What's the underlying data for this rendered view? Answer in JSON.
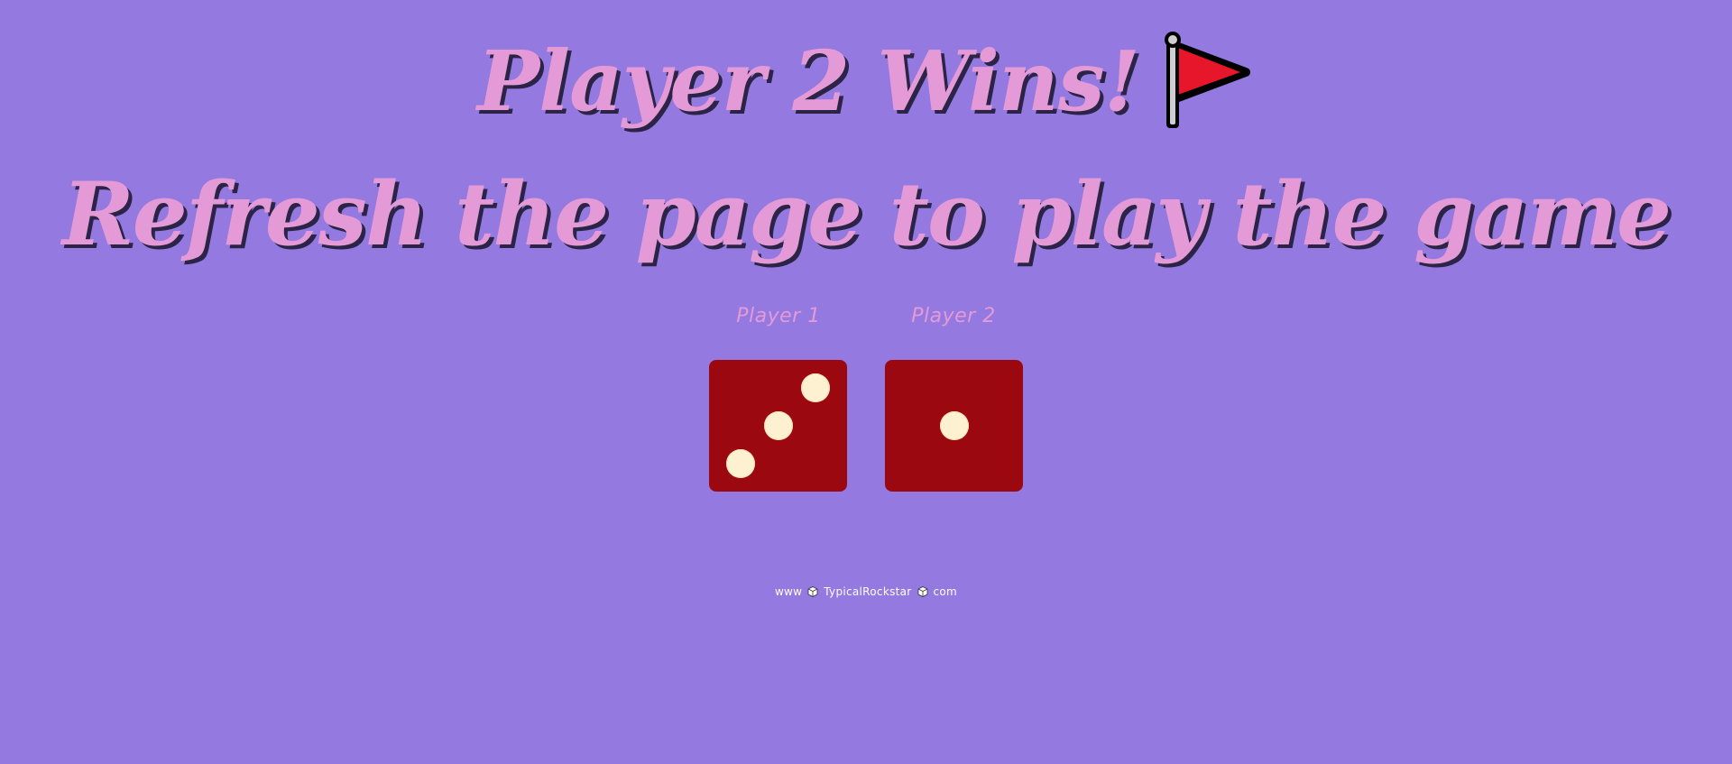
{
  "header": {
    "title": "Player 2 Wins!",
    "title_icon": "red-flag-icon",
    "subtitle": "Refresh the page to play the game"
  },
  "players": [
    {
      "label": "Player 1",
      "die_value": 3
    },
    {
      "label": "Player 2",
      "die_value": 1
    }
  ],
  "footer": {
    "prefix": "www",
    "brand": "TypicalRockstar",
    "suffix": "com",
    "separator_icon": "dice-cube-icon"
  },
  "colors": {
    "background": "#9379e0",
    "text_pink": "#e49ad6",
    "die_red": "#9b0810",
    "pip_cream": "#fdf1d2",
    "flag_red": "#e8162a"
  }
}
